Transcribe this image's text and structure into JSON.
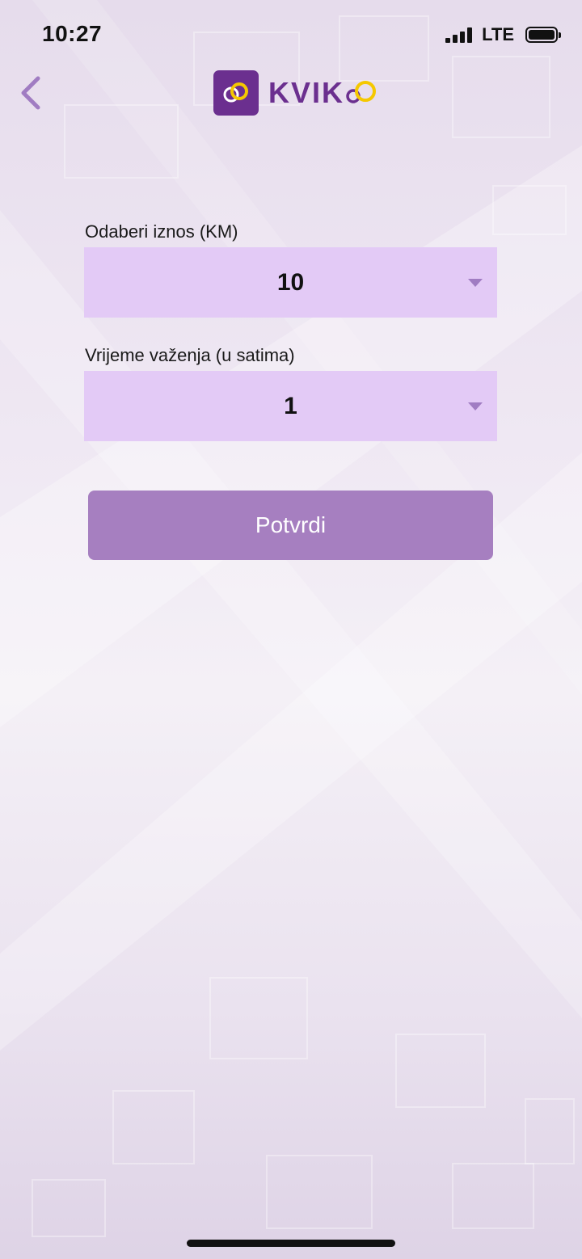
{
  "status_bar": {
    "time": "10:27",
    "network": "LTE"
  },
  "header": {
    "back_icon": "chevron-left-icon",
    "logo_text": "KVIK",
    "colors": {
      "brand_purple": "#6b2f8f",
      "brand_yellow": "#f5c800",
      "back_arrow": "#a07cc2"
    }
  },
  "form": {
    "amount": {
      "label": "Odaberi iznos (KM)",
      "value": "10"
    },
    "validity": {
      "label": "Vrijeme važenja (u satima)",
      "value": "1"
    },
    "confirm_label": "Potvrdi",
    "colors": {
      "select_bg": "#e3caf6",
      "button_bg": "#a67fc0",
      "chevron": "#a07cc2"
    }
  }
}
